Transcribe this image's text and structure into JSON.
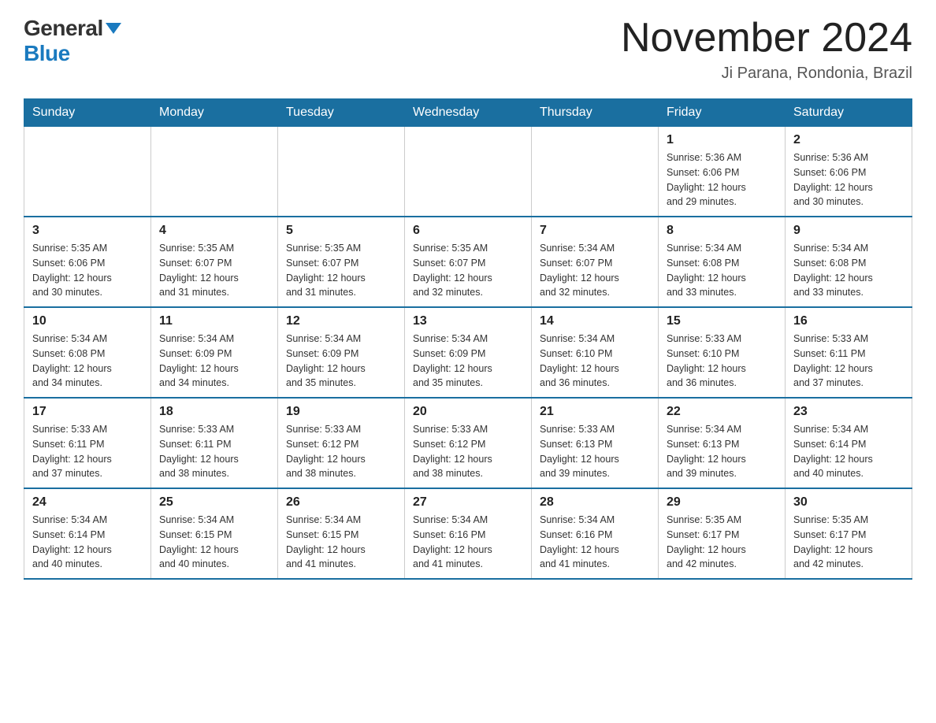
{
  "header": {
    "logo_general": "General",
    "logo_blue": "Blue",
    "month_title": "November 2024",
    "location": "Ji Parana, Rondonia, Brazil"
  },
  "calendar": {
    "days_of_week": [
      "Sunday",
      "Monday",
      "Tuesday",
      "Wednesday",
      "Thursday",
      "Friday",
      "Saturday"
    ],
    "weeks": [
      [
        {
          "day": "",
          "info": ""
        },
        {
          "day": "",
          "info": ""
        },
        {
          "day": "",
          "info": ""
        },
        {
          "day": "",
          "info": ""
        },
        {
          "day": "",
          "info": ""
        },
        {
          "day": "1",
          "info": "Sunrise: 5:36 AM\nSunset: 6:06 PM\nDaylight: 12 hours\nand 29 minutes."
        },
        {
          "day": "2",
          "info": "Sunrise: 5:36 AM\nSunset: 6:06 PM\nDaylight: 12 hours\nand 30 minutes."
        }
      ],
      [
        {
          "day": "3",
          "info": "Sunrise: 5:35 AM\nSunset: 6:06 PM\nDaylight: 12 hours\nand 30 minutes."
        },
        {
          "day": "4",
          "info": "Sunrise: 5:35 AM\nSunset: 6:07 PM\nDaylight: 12 hours\nand 31 minutes."
        },
        {
          "day": "5",
          "info": "Sunrise: 5:35 AM\nSunset: 6:07 PM\nDaylight: 12 hours\nand 31 minutes."
        },
        {
          "day": "6",
          "info": "Sunrise: 5:35 AM\nSunset: 6:07 PM\nDaylight: 12 hours\nand 32 minutes."
        },
        {
          "day": "7",
          "info": "Sunrise: 5:34 AM\nSunset: 6:07 PM\nDaylight: 12 hours\nand 32 minutes."
        },
        {
          "day": "8",
          "info": "Sunrise: 5:34 AM\nSunset: 6:08 PM\nDaylight: 12 hours\nand 33 minutes."
        },
        {
          "day": "9",
          "info": "Sunrise: 5:34 AM\nSunset: 6:08 PM\nDaylight: 12 hours\nand 33 minutes."
        }
      ],
      [
        {
          "day": "10",
          "info": "Sunrise: 5:34 AM\nSunset: 6:08 PM\nDaylight: 12 hours\nand 34 minutes."
        },
        {
          "day": "11",
          "info": "Sunrise: 5:34 AM\nSunset: 6:09 PM\nDaylight: 12 hours\nand 34 minutes."
        },
        {
          "day": "12",
          "info": "Sunrise: 5:34 AM\nSunset: 6:09 PM\nDaylight: 12 hours\nand 35 minutes."
        },
        {
          "day": "13",
          "info": "Sunrise: 5:34 AM\nSunset: 6:09 PM\nDaylight: 12 hours\nand 35 minutes."
        },
        {
          "day": "14",
          "info": "Sunrise: 5:34 AM\nSunset: 6:10 PM\nDaylight: 12 hours\nand 36 minutes."
        },
        {
          "day": "15",
          "info": "Sunrise: 5:33 AM\nSunset: 6:10 PM\nDaylight: 12 hours\nand 36 minutes."
        },
        {
          "day": "16",
          "info": "Sunrise: 5:33 AM\nSunset: 6:11 PM\nDaylight: 12 hours\nand 37 minutes."
        }
      ],
      [
        {
          "day": "17",
          "info": "Sunrise: 5:33 AM\nSunset: 6:11 PM\nDaylight: 12 hours\nand 37 minutes."
        },
        {
          "day": "18",
          "info": "Sunrise: 5:33 AM\nSunset: 6:11 PM\nDaylight: 12 hours\nand 38 minutes."
        },
        {
          "day": "19",
          "info": "Sunrise: 5:33 AM\nSunset: 6:12 PM\nDaylight: 12 hours\nand 38 minutes."
        },
        {
          "day": "20",
          "info": "Sunrise: 5:33 AM\nSunset: 6:12 PM\nDaylight: 12 hours\nand 38 minutes."
        },
        {
          "day": "21",
          "info": "Sunrise: 5:33 AM\nSunset: 6:13 PM\nDaylight: 12 hours\nand 39 minutes."
        },
        {
          "day": "22",
          "info": "Sunrise: 5:34 AM\nSunset: 6:13 PM\nDaylight: 12 hours\nand 39 minutes."
        },
        {
          "day": "23",
          "info": "Sunrise: 5:34 AM\nSunset: 6:14 PM\nDaylight: 12 hours\nand 40 minutes."
        }
      ],
      [
        {
          "day": "24",
          "info": "Sunrise: 5:34 AM\nSunset: 6:14 PM\nDaylight: 12 hours\nand 40 minutes."
        },
        {
          "day": "25",
          "info": "Sunrise: 5:34 AM\nSunset: 6:15 PM\nDaylight: 12 hours\nand 40 minutes."
        },
        {
          "day": "26",
          "info": "Sunrise: 5:34 AM\nSunset: 6:15 PM\nDaylight: 12 hours\nand 41 minutes."
        },
        {
          "day": "27",
          "info": "Sunrise: 5:34 AM\nSunset: 6:16 PM\nDaylight: 12 hours\nand 41 minutes."
        },
        {
          "day": "28",
          "info": "Sunrise: 5:34 AM\nSunset: 6:16 PM\nDaylight: 12 hours\nand 41 minutes."
        },
        {
          "day": "29",
          "info": "Sunrise: 5:35 AM\nSunset: 6:17 PM\nDaylight: 12 hours\nand 42 minutes."
        },
        {
          "day": "30",
          "info": "Sunrise: 5:35 AM\nSunset: 6:17 PM\nDaylight: 12 hours\nand 42 minutes."
        }
      ]
    ]
  }
}
